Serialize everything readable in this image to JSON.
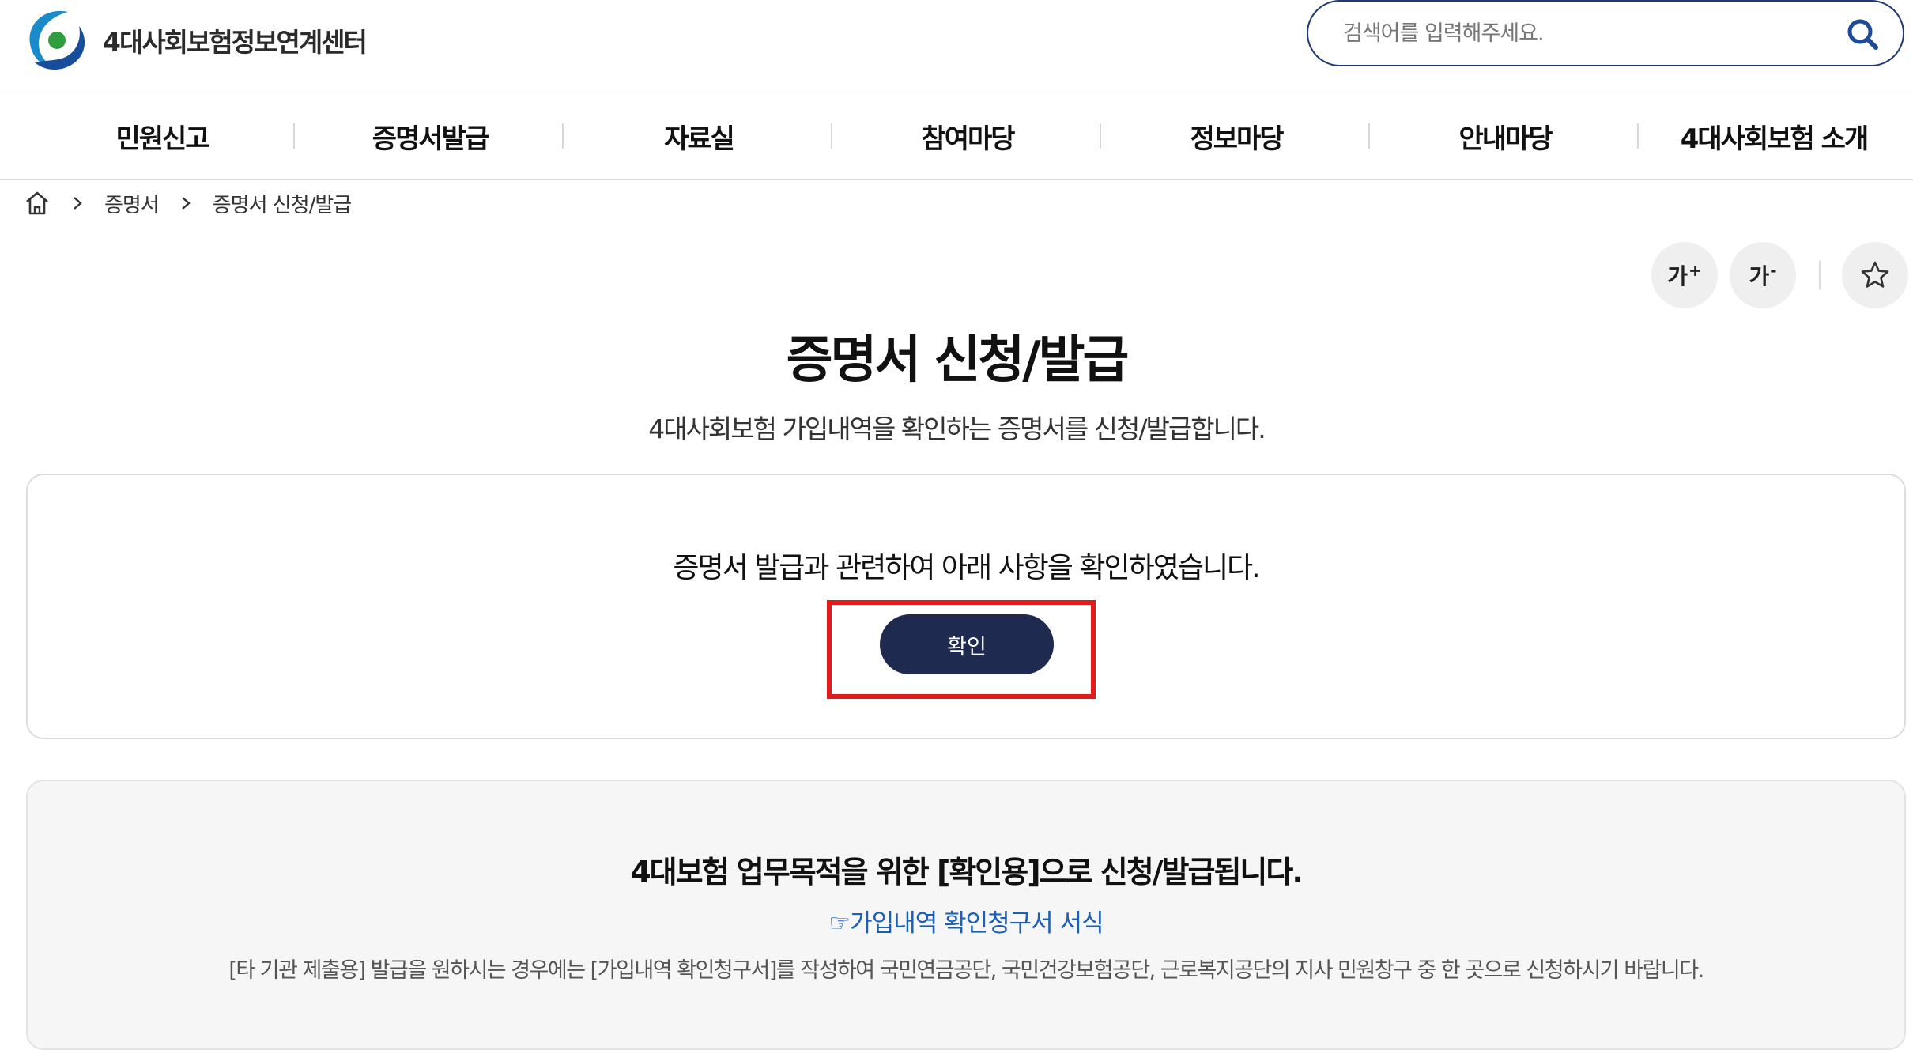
{
  "header": {
    "logo_text": "4대사회보험정보연계센터",
    "search_placeholder": "검색어를 입력해주세요."
  },
  "nav": {
    "items": [
      {
        "label": "민원신고"
      },
      {
        "label": "증명서발급"
      },
      {
        "label": "자료실"
      },
      {
        "label": "참여마당"
      },
      {
        "label": "정보마당"
      },
      {
        "label": "안내마당"
      },
      {
        "label": "4대사회보험 소개"
      }
    ]
  },
  "breadcrumb": {
    "level1": "증명서",
    "level2": "증명서 신청/발급"
  },
  "tools": {
    "font_increase": "가",
    "font_decrease": "가",
    "plus_mark": "+",
    "minus_mark": "-"
  },
  "page": {
    "title": "증명서 신청/발급",
    "subtitle": "4대사회보험 가입내역을 확인하는 증명서를 신청/발급합니다."
  },
  "confirm": {
    "text": "증명서 발급과 관련하여 아래 사항을 확인하였습니다.",
    "button_label": "확인"
  },
  "info": {
    "title": "4대보험 업무목적을 위한 [확인용]으로 신청/발급됩니다.",
    "link_icon": "☞",
    "link_text": "가입내역 확인청구서 서식",
    "description": "[타 기관 제출용] 발급을 원하시는 경우에는 [가입내역 확인청구서]를 작성하여 국민연금공단, 국민건강보험공단, 근로복지공단의 지사 민원창구 중 한 곳으로 신청하시기 바랍니다."
  },
  "colors": {
    "navy": "#1e2a50",
    "search_border": "#1e3a6e",
    "highlight": "#e01d1d",
    "link": "#1b5fb6"
  }
}
